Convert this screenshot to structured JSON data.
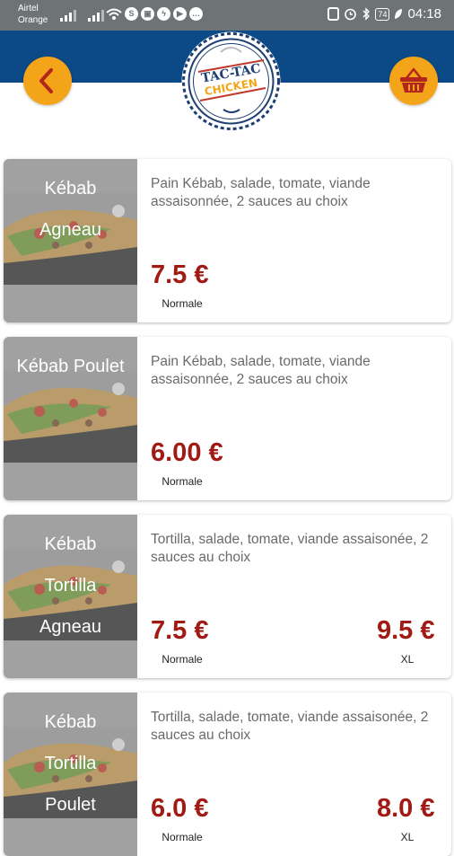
{
  "status_bar": {
    "carrier_line1": "Airtel",
    "carrier_line2": "Orange",
    "battery": "74",
    "time": "04:18"
  },
  "header": {
    "logo_line1": "TAC-TAC",
    "logo_line2": "CHICKEN",
    "brand_colors": {
      "navy": "#0b4a86",
      "orange": "#f4a419"
    }
  },
  "products": [
    {
      "name_lines": [
        "Kébab",
        "Agneau"
      ],
      "description": "Pain Kébab, salade, tomate, viande assaisonnée, 2 sauces au choix",
      "prices": [
        {
          "price": "7.5 €",
          "size": "Normale"
        }
      ]
    },
    {
      "name_lines": [
        "Kébab Poulet"
      ],
      "description": "Pain Kébab, salade, tomate, viande assaisonnée, 2 sauces au choix",
      "prices": [
        {
          "price": "6.00 €",
          "size": "Normale"
        }
      ]
    },
    {
      "name_lines": [
        "Kébab",
        "Tortilla",
        "Agneau"
      ],
      "description": "Tortilla, salade, tomate, viande assaisonée, 2 sauces au choix",
      "prices": [
        {
          "price": "7.5 €",
          "size": "Normale"
        },
        {
          "price": "9.5 €",
          "size": "XL"
        }
      ]
    },
    {
      "name_lines": [
        "Kébab",
        "Tortilla",
        "Poulet"
      ],
      "description": "Tortilla, salade, tomate, viande assaisonée, 2 sauces au choix",
      "prices": [
        {
          "price": "6.0 €",
          "size": "Normale"
        },
        {
          "price": "8.0 €",
          "size": "XL"
        }
      ]
    }
  ]
}
